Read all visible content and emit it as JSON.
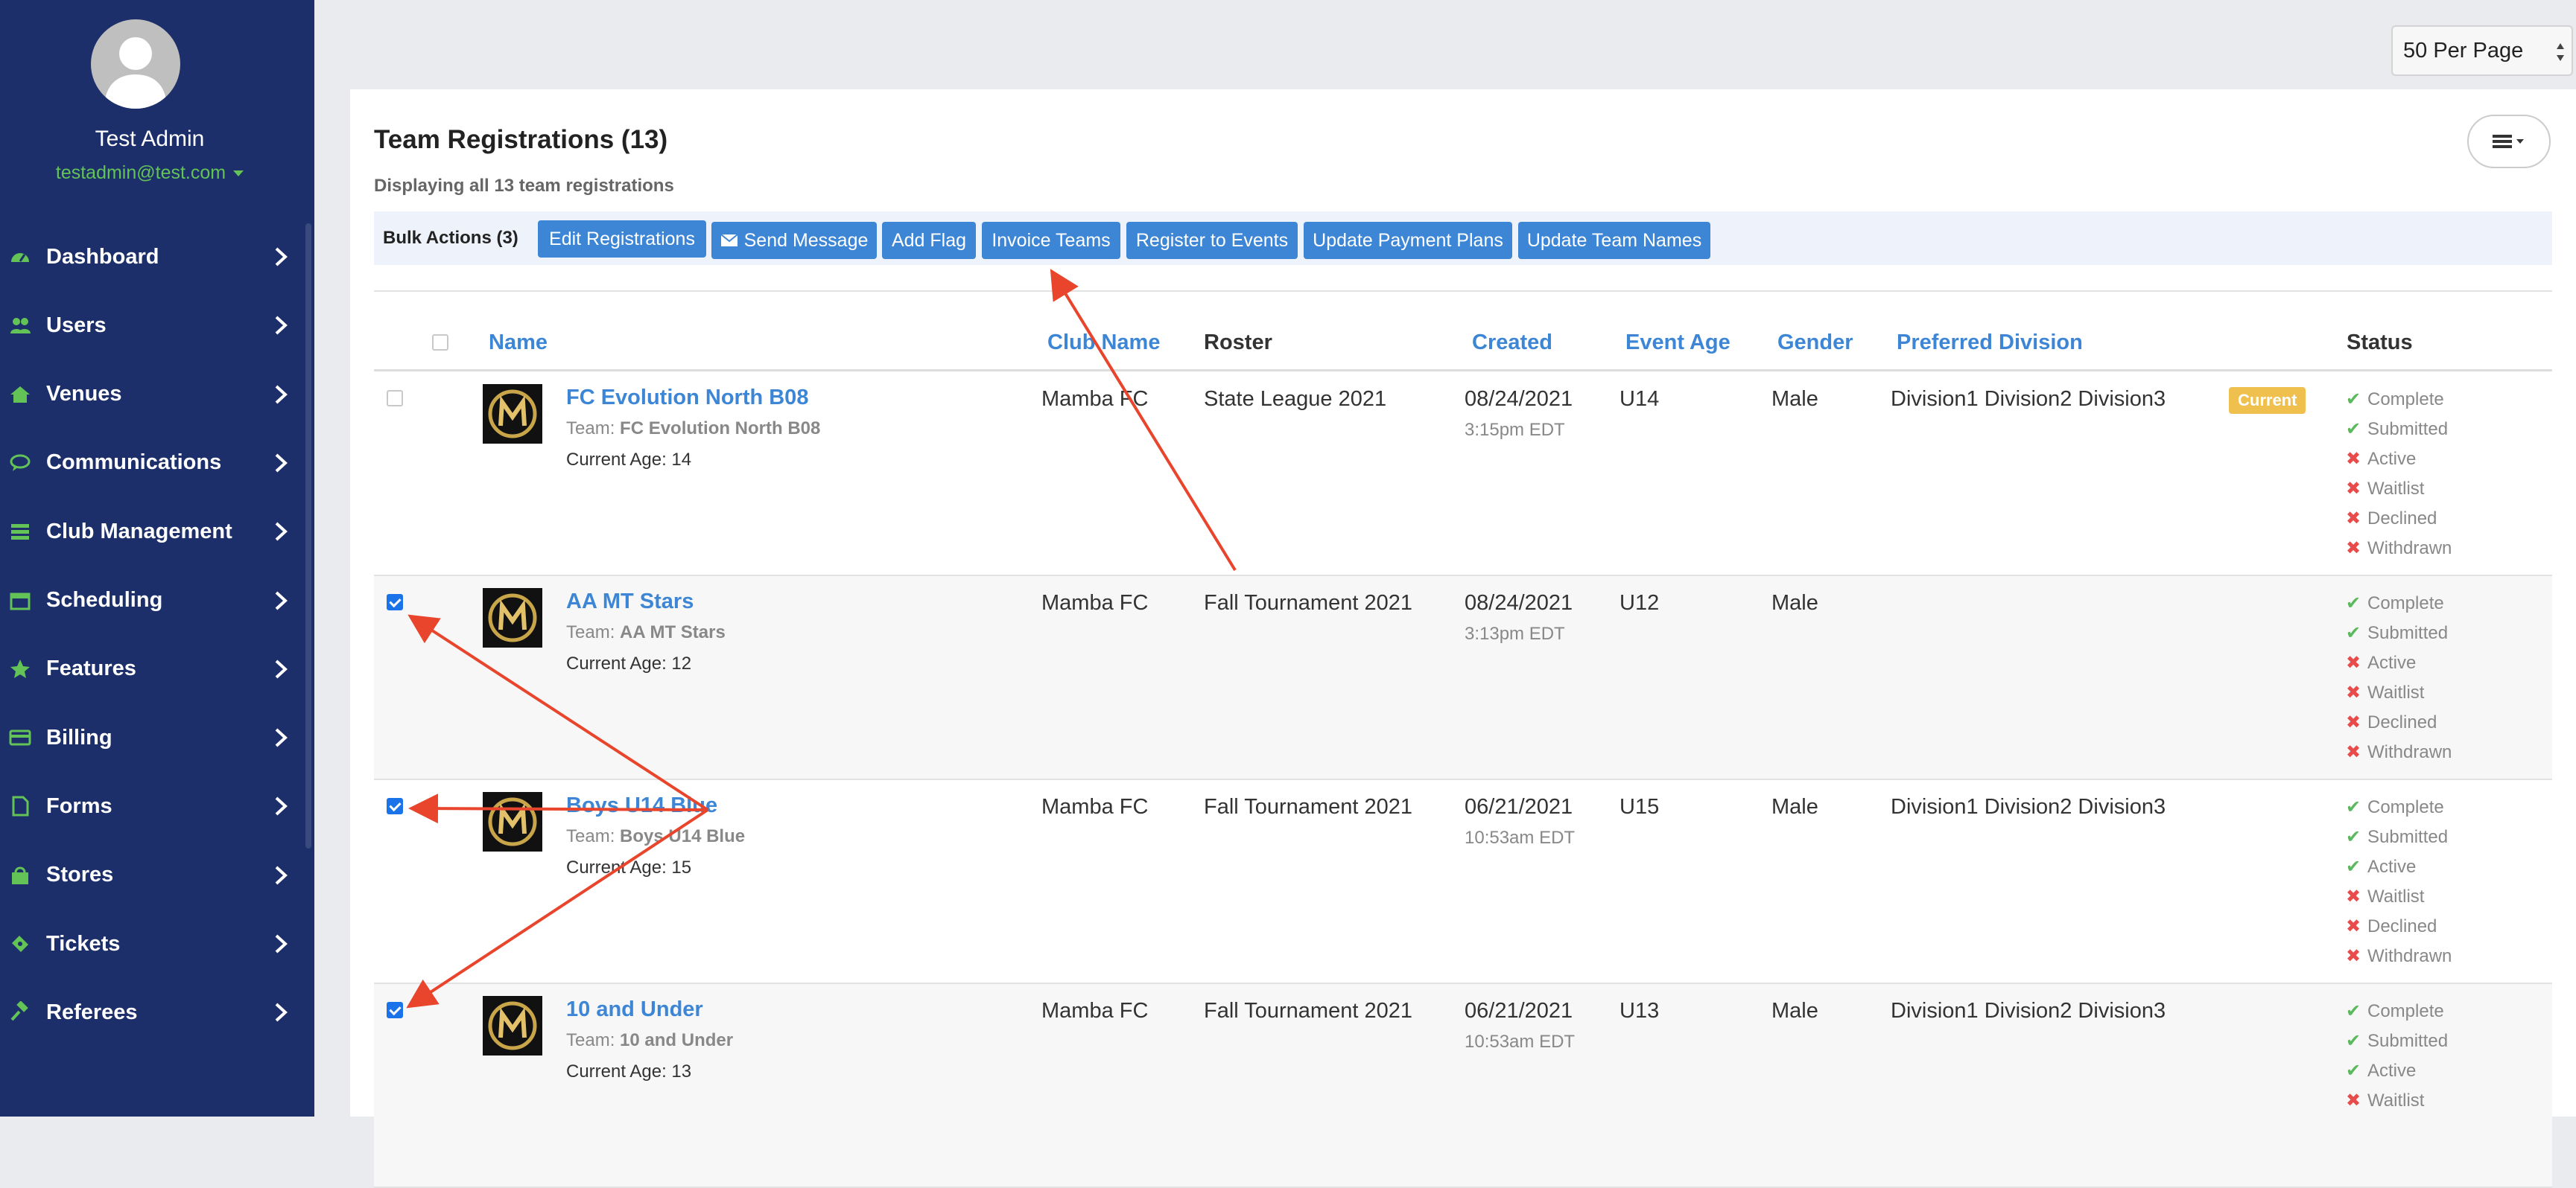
{
  "sidebar": {
    "user_name": "Test Admin",
    "user_email": "testadmin@test.com",
    "items": [
      {
        "label": "Dashboard",
        "icon": "dashboard-icon"
      },
      {
        "label": "Users",
        "icon": "users-icon"
      },
      {
        "label": "Venues",
        "icon": "home-icon"
      },
      {
        "label": "Communications",
        "icon": "chat-icon"
      },
      {
        "label": "Club Management",
        "icon": "list-icon"
      },
      {
        "label": "Scheduling",
        "icon": "calendar-icon"
      },
      {
        "label": "Features",
        "icon": "star-icon"
      },
      {
        "label": "Billing",
        "icon": "credit-card-icon"
      },
      {
        "label": "Forms",
        "icon": "file-icon"
      },
      {
        "label": "Stores",
        "icon": "shopping-bag-icon"
      },
      {
        "label": "Tickets",
        "icon": "ticket-icon"
      },
      {
        "label": "Referees",
        "icon": "gavel-icon"
      }
    ],
    "accent": "#63c356",
    "bg": "#1c2f6a"
  },
  "toolbar": {
    "per_page": "50 Per Page"
  },
  "page": {
    "title": "Team Registrations (13)",
    "subtitle": "Displaying all 13 team registrations"
  },
  "bulk": {
    "label": "Bulk Actions (3)",
    "buttons": [
      "Edit Registrations",
      "Send Message",
      "Add Flag",
      "Invoice Teams",
      "Register to Events",
      "Update Payment Plans",
      "Update Team Names"
    ]
  },
  "table": {
    "headers": [
      "Name",
      "Club Name",
      "Roster",
      "Created",
      "Event Age",
      "Gender",
      "Preferred Division",
      "Status"
    ],
    "team_prefix": "Team: ",
    "age_prefix": "Current Age: ",
    "rows": [
      {
        "name": "FC Evolution North B08",
        "team": "FC Evolution North B08",
        "age": "14",
        "club": "Mamba FC",
        "roster": "State League 2021",
        "date": "08/24/2021",
        "time": "3:15pm EDT",
        "event_age": "U14",
        "gender": "Male",
        "division": "Division1 Division2 Division3",
        "badge": "Current",
        "checked": false,
        "statuses": [
          [
            "Complete",
            true
          ],
          [
            "Submitted",
            true
          ],
          [
            "Active",
            false
          ],
          [
            "Waitlist",
            false
          ],
          [
            "Declined",
            false
          ],
          [
            "Withdrawn",
            false
          ]
        ]
      },
      {
        "name": "AA MT Stars",
        "team": "AA MT Stars",
        "age": "12",
        "club": "Mamba FC",
        "roster": "Fall Tournament 2021",
        "date": "08/24/2021",
        "time": "3:13pm EDT",
        "event_age": "U12",
        "gender": "Male",
        "division": "",
        "badge": "",
        "checked": true,
        "statuses": [
          [
            "Complete",
            true
          ],
          [
            "Submitted",
            true
          ],
          [
            "Active",
            false
          ],
          [
            "Waitlist",
            false
          ],
          [
            "Declined",
            false
          ],
          [
            "Withdrawn",
            false
          ]
        ]
      },
      {
        "name": "Boys U14 Blue",
        "team": "Boys U14 Blue",
        "age": "15",
        "club": "Mamba FC",
        "roster": "Fall Tournament 2021",
        "date": "06/21/2021",
        "time": "10:53am EDT",
        "event_age": "U15",
        "gender": "Male",
        "division": "Division1 Division2 Division3",
        "badge": "",
        "checked": true,
        "statuses": [
          [
            "Complete",
            true
          ],
          [
            "Submitted",
            true
          ],
          [
            "Active",
            true
          ],
          [
            "Waitlist",
            false
          ],
          [
            "Declined",
            false
          ],
          [
            "Withdrawn",
            false
          ]
        ]
      },
      {
        "name": "10 and Under",
        "team": "10 and Under",
        "age": "13",
        "club": "Mamba FC",
        "roster": "Fall Tournament 2021",
        "date": "06/21/2021",
        "time": "10:53am EDT",
        "event_age": "U13",
        "gender": "Male",
        "division": "Division1 Division2 Division3",
        "badge": "",
        "checked": true,
        "statuses": [
          [
            "Complete",
            true
          ],
          [
            "Submitted",
            true
          ],
          [
            "Active",
            true
          ],
          [
            "Waitlist",
            false
          ]
        ]
      }
    ]
  },
  "colors": {
    "link": "#3d86d6",
    "ok": "#5cb85c",
    "no": "#e84b4b",
    "badge": "#f0c04e",
    "annotation": "#e8452c"
  }
}
